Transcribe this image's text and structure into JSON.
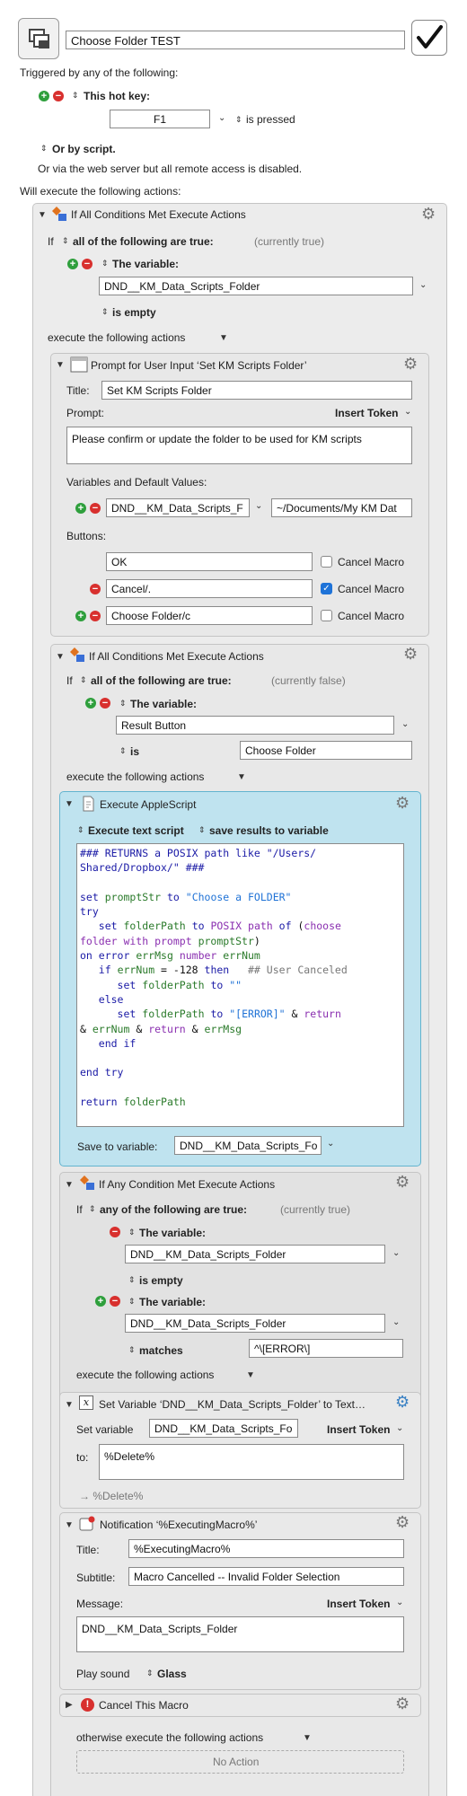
{
  "macro": {
    "name": "Choose Folder TEST"
  },
  "trigger": {
    "header": "Triggered by any of the following:",
    "hotkey_label": "This hot key:",
    "hotkey_value": "F1",
    "hotkey_state": "is pressed",
    "or_script": "Or by script.",
    "web_note": "Or via the web server but all remote access is disabled."
  },
  "will_execute": "Will execute the following actions:",
  "if1": {
    "title": "If All Conditions Met Execute Actions",
    "if_word": "If",
    "match": "all of the following are true:",
    "status": "(currently true)",
    "cond_type": "The variable:",
    "var_name": "DND__KM_Data_Scripts_Folder",
    "cond_op": "is empty",
    "execute_label": "execute the following actions"
  },
  "prompt": {
    "title": "Prompt for User Input ‘Set KM Scripts Folder’",
    "title_label": "Title:",
    "title_value": "Set KM Scripts Folder",
    "prompt_label": "Prompt:",
    "insert_token": "Insert Token",
    "prompt_text": "Please confirm or update the folder to be used for KM scripts",
    "vars_label": "Variables and Default Values:",
    "var_name": "DND__KM_Data_Scripts_F",
    "var_default": "~/Documents/My KM Dat",
    "buttons_label": "Buttons:",
    "buttons": [
      {
        "label": "OK",
        "cancel": "Cancel Macro",
        "checked": false
      },
      {
        "label": "Cancel/.",
        "cancel": "Cancel Macro",
        "checked": true
      },
      {
        "label": "Choose Folder/c",
        "cancel": "Cancel Macro",
        "checked": false
      }
    ]
  },
  "if2": {
    "title": "If All Conditions Met Execute Actions",
    "if_word": "If",
    "match": "all of the following are true:",
    "status": "(currently false)",
    "cond_type": "The variable:",
    "var_name": "Result Button",
    "cond_op": "is",
    "cond_value": "Choose Folder",
    "execute_label": "execute the following actions"
  },
  "applescript": {
    "title": "Execute AppleScript",
    "mode": "Execute text script",
    "save_mode": "save results to variable",
    "save_label": "Save to variable:",
    "save_var": "DND__KM_Data_Scripts_Fo"
  },
  "if3": {
    "title": "If Any Condition Met Execute Actions",
    "if_word": "If",
    "match": "any of the following are true:",
    "status": "(currently true)",
    "cond1_type": "The variable:",
    "cond1_var": "DND__KM_Data_Scripts_Folder",
    "cond1_op": "is empty",
    "cond2_type": "The variable:",
    "cond2_var": "DND__KM_Data_Scripts_Folder",
    "cond2_op": "matches",
    "cond2_value": "^\\[ERROR\\]",
    "execute_label": "execute the following actions"
  },
  "setvar": {
    "title": "Set Variable ‘DND__KM_Data_Scripts_Folder’ to Text…",
    "set_label": "Set variable",
    "var_name": "DND__KM_Data_Scripts_Fo",
    "insert_token": "Insert Token",
    "to_label": "to:",
    "to_value": "%Delete%",
    "preview": "→ %Delete%"
  },
  "notify": {
    "title": "Notification ‘%ExecutingMacro%’",
    "title_label": "Title:",
    "title_value": "%ExecutingMacro%",
    "subtitle_label": "Subtitle:",
    "subtitle_value": "Macro Cancelled -- Invalid Folder Selection",
    "message_label": "Message:",
    "insert_token": "Insert Token",
    "message_value": "DND__KM_Data_Scripts_Folder",
    "sound_label": "Play sound",
    "sound_value": "Glass"
  },
  "cancel": {
    "title": "Cancel This Macro",
    "otherwise": "otherwise execute the following actions",
    "no_action": "No Action"
  },
  "colors": {
    "plus": "#2e9f3c",
    "minus": "#d8302e",
    "applescript_bg": "#bfe3ef",
    "checkbox_on": "#1e73d8"
  },
  "icons": [
    "macro-group-icon",
    "checkmark-icon",
    "plus-icon",
    "minus-icon",
    "gear-icon",
    "disclosure-triangle-icon",
    "if-then-icon",
    "prompt-window-icon",
    "applescript-icon",
    "set-variable-icon",
    "notification-icon",
    "cancel-icon"
  ]
}
